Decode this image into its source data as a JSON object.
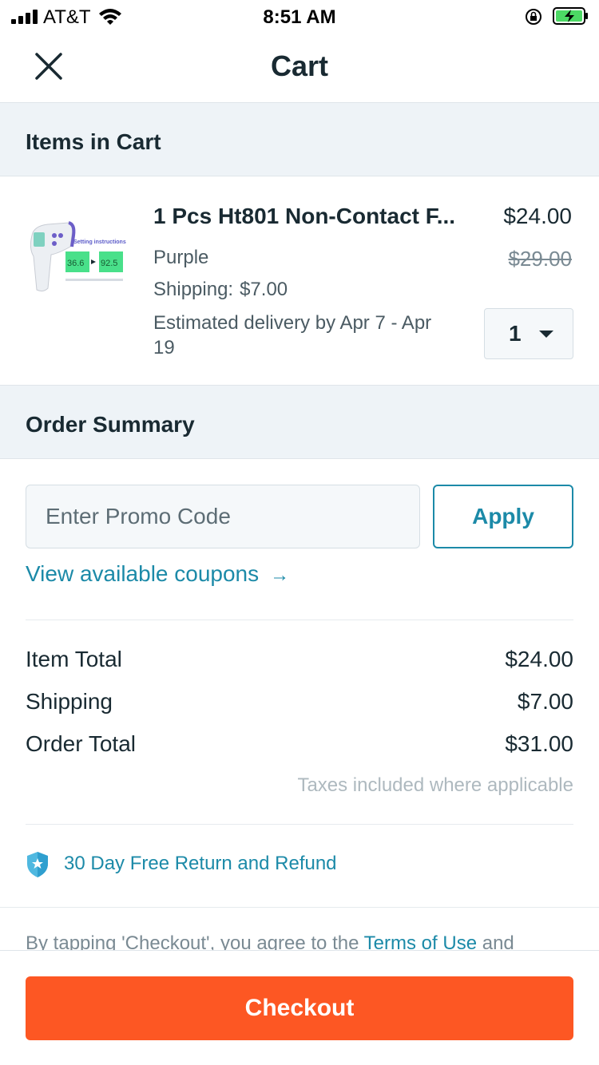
{
  "status_bar": {
    "carrier": "AT&T",
    "time": "8:51 AM"
  },
  "header": {
    "title": "Cart"
  },
  "items_section": {
    "title": "Items in Cart"
  },
  "item": {
    "title": "1 Pcs Ht801 Non-Contact F...",
    "variant": "Purple",
    "shipping_label": "Shipping:",
    "shipping_value": "$7.00",
    "delivery": "Estimated delivery by Apr 7 - Apr 19",
    "price": "$24.00",
    "original_price": "$29.00",
    "quantity": "1",
    "thumb_header": "Setting instructions",
    "thumb_reading_left": "36.6",
    "thumb_reading_right": "92.5"
  },
  "summary_section": {
    "title": "Order Summary"
  },
  "promo": {
    "placeholder": "Enter Promo Code",
    "apply_label": "Apply",
    "coupons_link": "View available coupons",
    "coupons_arrow": "→"
  },
  "totals": {
    "item_total_label": "Item Total",
    "item_total_value": "$24.00",
    "shipping_label": "Shipping",
    "shipping_value": "$7.00",
    "order_total_label": "Order Total",
    "order_total_value": "$31.00",
    "tax_note": "Taxes included where applicable"
  },
  "guarantee": {
    "text": "30 Day Free Return and Refund"
  },
  "terms": {
    "prefix": "By tapping 'Checkout', you agree to the",
    "link": "Terms of Use",
    "suffix": "and"
  },
  "checkout": {
    "label": "Checkout"
  },
  "colors": {
    "accent": "#1c8aa8",
    "checkout": "#fd5723",
    "section_bg": "#eef3f7",
    "text": "#192a32"
  }
}
